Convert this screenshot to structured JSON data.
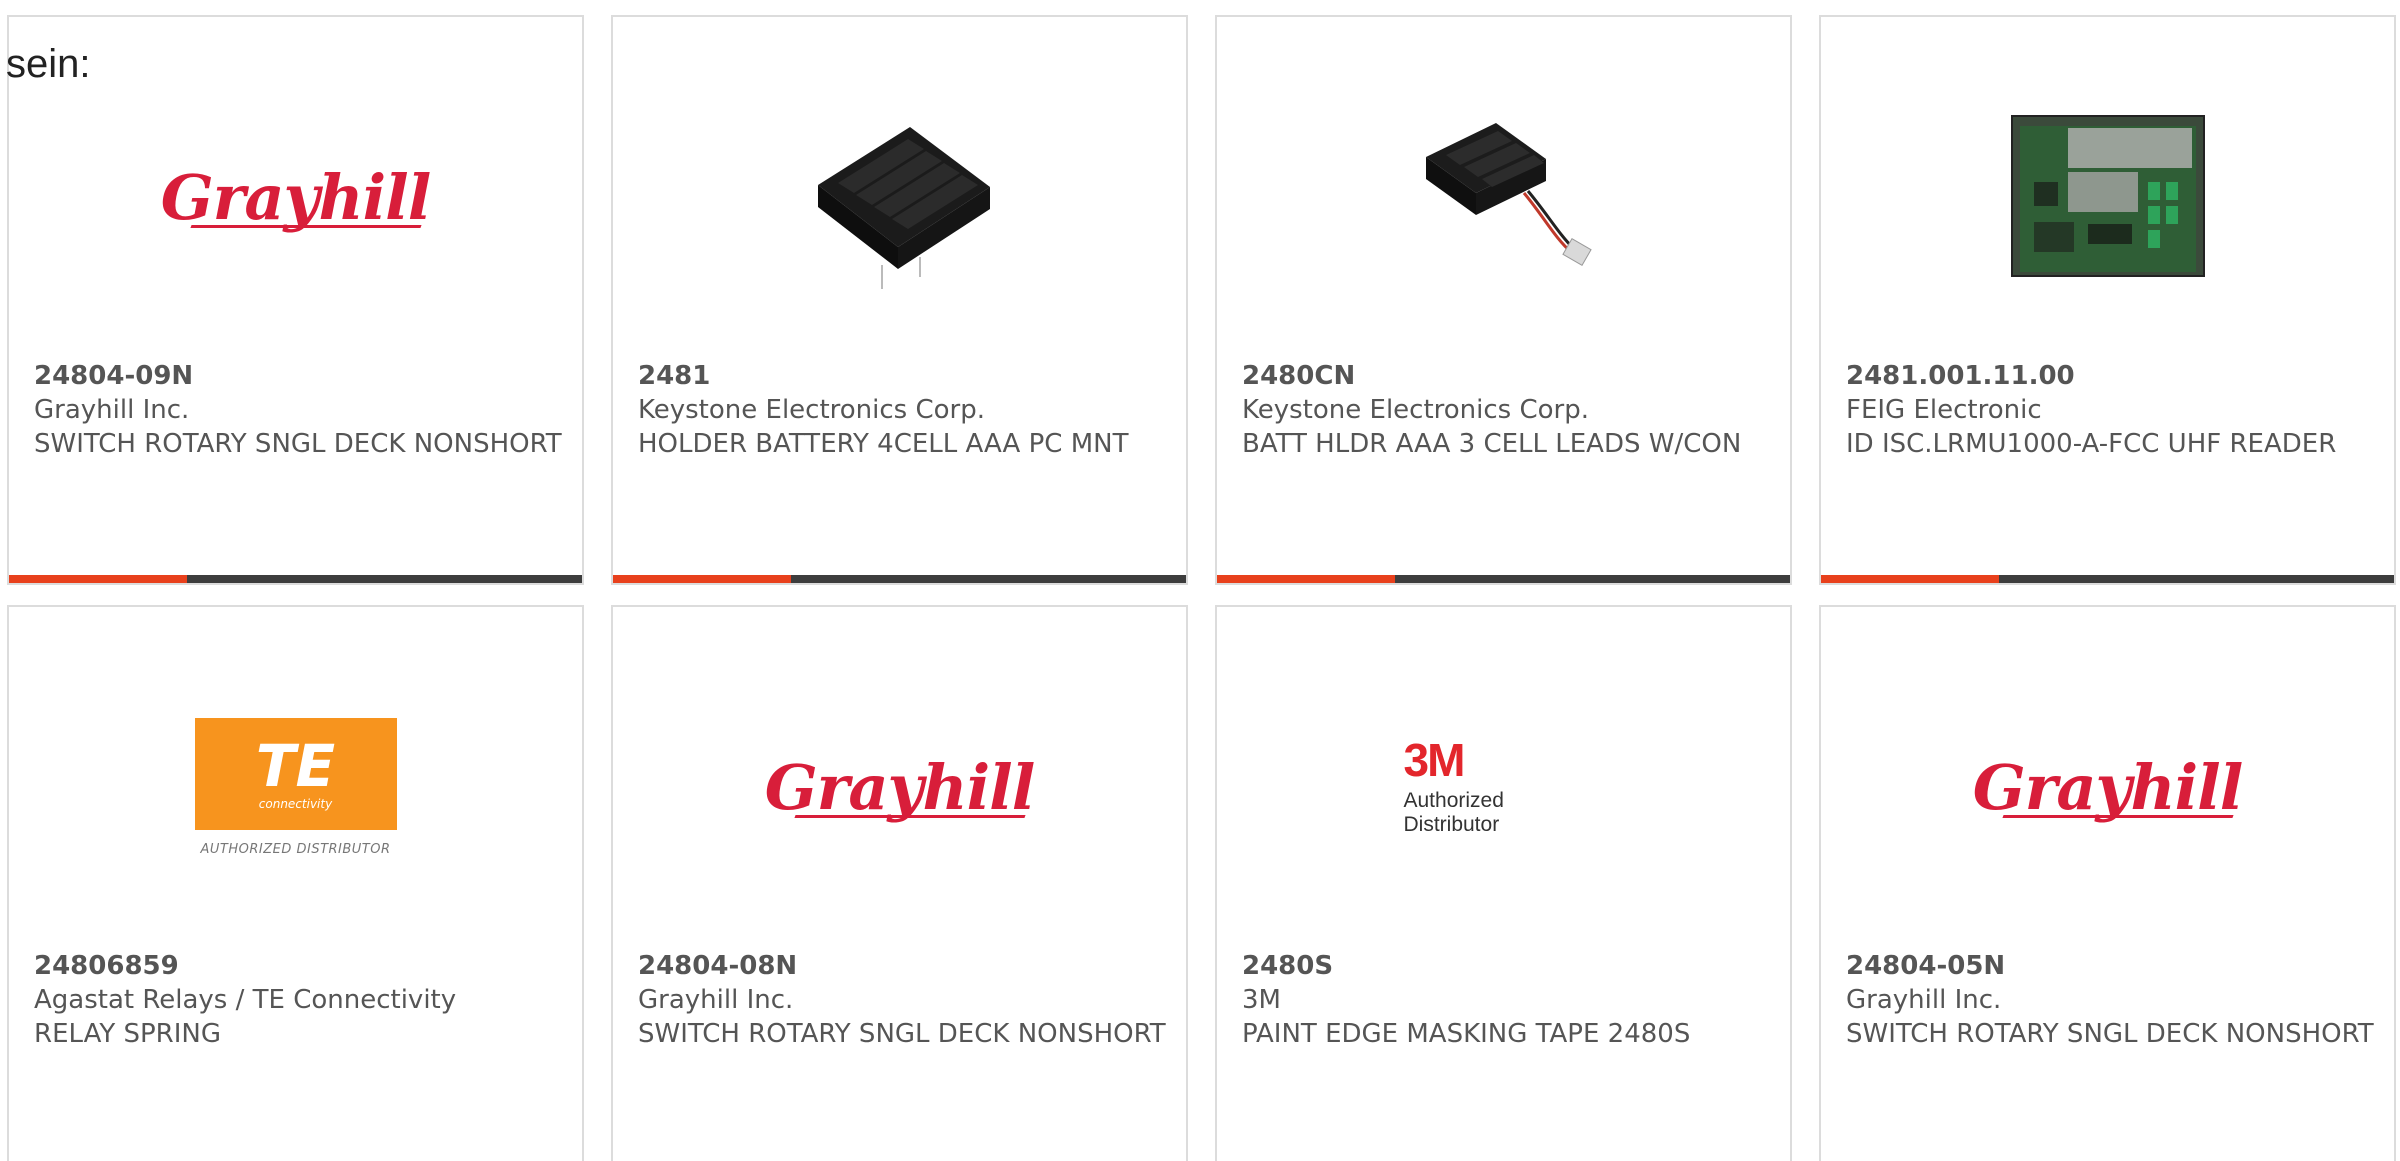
{
  "intro_text": "sein:",
  "products": [
    {
      "part_number": "24804-09N",
      "manufacturer": "Grayhill Inc.",
      "description": "SWITCH ROTARY SNGL DECK NONSHORT",
      "image": "grayhill-logo",
      "logo_text": "Grayhill",
      "progress_fraction": 0.31
    },
    {
      "part_number": "2481",
      "manufacturer": "Keystone Electronics Corp.",
      "description": "HOLDER BATTERY 4CELL AAA PC MNT",
      "image": "battery-holder-4cell-photo",
      "progress_fraction": 0.31
    },
    {
      "part_number": "2480CN",
      "manufacturer": "Keystone Electronics Corp.",
      "description": "BATT HLDR AAA 3 CELL LEADS W/CON",
      "image": "battery-holder-3cell-photo",
      "progress_fraction": 0.31
    },
    {
      "part_number": "2481.001.11.00",
      "manufacturer": "FEIG Electronic",
      "description": "ID ISC.LRMU1000-A-FCC UHF READER",
      "image": "circuit-board-photo",
      "progress_fraction": 0.31
    },
    {
      "part_number": "24806859",
      "manufacturer": "Agastat Relays / TE Connectivity",
      "description": "RELAY SPRING",
      "image": "te-connectivity-logo",
      "logo_text": "TE",
      "logo_subtext": "connectivity",
      "logo_caption": "AUTHORIZED DISTRIBUTOR"
    },
    {
      "part_number": "24804-08N",
      "manufacturer": "Grayhill Inc.",
      "description": "SWITCH ROTARY SNGL DECK NONSHORT",
      "image": "grayhill-logo",
      "logo_text": "Grayhill"
    },
    {
      "part_number": "2480S",
      "manufacturer": "3M",
      "description": "PAINT EDGE MASKING TAPE 2480S",
      "image": "3m-logo",
      "logo_text": "3M",
      "logo_caption": "Authorized Distributor"
    },
    {
      "part_number": "24804-05N",
      "manufacturer": "Grayhill Inc.",
      "description": "SWITCH ROTARY SNGL DECK NONSHORT",
      "image": "grayhill-logo",
      "logo_text": "Grayhill"
    }
  ],
  "colors": {
    "progress_fill": "#e8401c",
    "progress_track": "#3d3d3d",
    "card_border": "#dcdcdc",
    "text": "#555555",
    "grayhill_red": "#d81e3a",
    "te_orange": "#f7941e",
    "3m_red": "#e3262c"
  }
}
